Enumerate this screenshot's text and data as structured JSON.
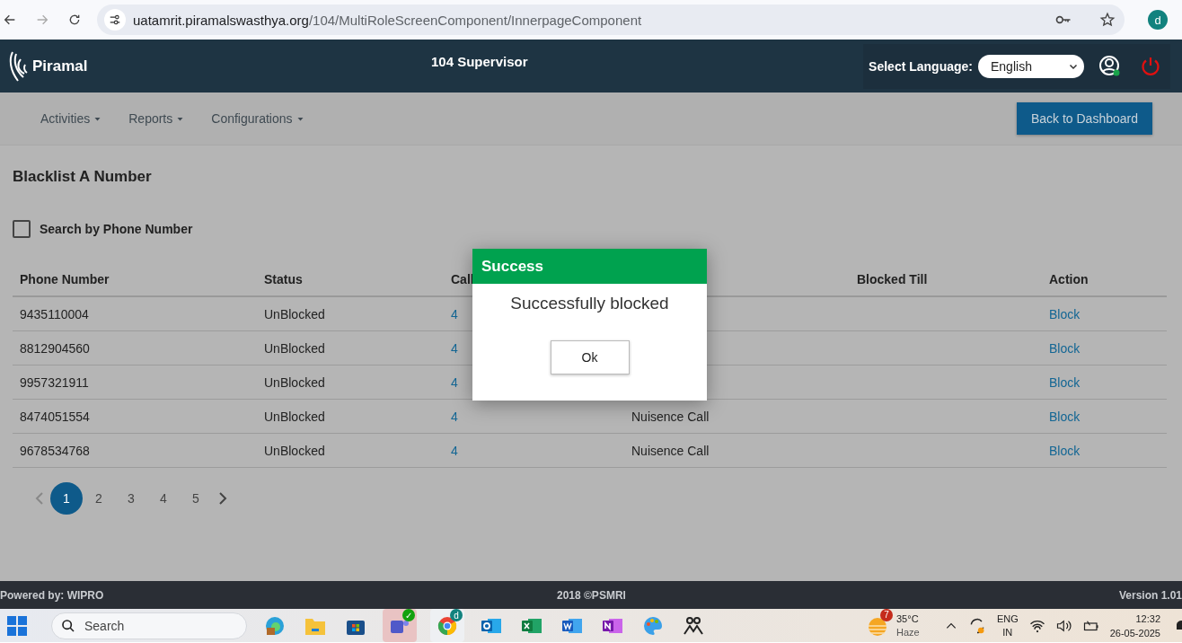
{
  "browser": {
    "url_host": "uatamrit.piramalswasthya.org",
    "url_path": "/104/MultiRoleScreenComponent/InnerpageComponent",
    "profile_initial": "d"
  },
  "header": {
    "logo_text": "Piramal",
    "title": "104 Supervisor",
    "language_label": "Select Language:",
    "language_value": "English"
  },
  "nav": {
    "menus": [
      {
        "label": "Activities"
      },
      {
        "label": "Reports"
      },
      {
        "label": "Configurations"
      }
    ],
    "back_button": "Back to Dashboard"
  },
  "page": {
    "title": "Blacklist A Number",
    "search_checkbox": {
      "label": "Search by Phone Number",
      "checked": false
    }
  },
  "table": {
    "header": {
      "phone_number": "Phone Number",
      "status": "Status",
      "column_3": "Call",
      "blocked_till": "Blocked Till",
      "action": "Action"
    },
    "rows": [
      {
        "phone_number": "9435110004",
        "status": "UnBlocked",
        "column_3": "4",
        "action": "Block"
      },
      {
        "phone_number": "8812904560",
        "status": "UnBlocked",
        "column_3": "4",
        "action": "Block"
      },
      {
        "phone_number": "9957321911",
        "status": "UnBlocked",
        "column_3": "4",
        "action": "Block"
      },
      {
        "phone_number": "8474051554",
        "status": "UnBlocked",
        "column_3": "4",
        "column_4": "Nuisence Call",
        "action": "Block"
      },
      {
        "phone_number": "9678534768",
        "status": "UnBlocked",
        "column_3": "4",
        "column_4": "Nuisence Call",
        "action": "Block"
      }
    ]
  },
  "pagination": {
    "pages": [
      {
        "label": "1",
        "selected": true
      },
      {
        "label": "2",
        "selected": false
      },
      {
        "label": "3",
        "selected": false
      },
      {
        "label": "4",
        "selected": false
      },
      {
        "label": "5",
        "selected": false
      }
    ]
  },
  "modal": {
    "title": "Success",
    "message": "Successfully blocked",
    "button": "Ok"
  },
  "footer": {
    "left": "Powered by: WIPRO",
    "center": "2018 ©PSMRI",
    "right": "Version 1.01"
  },
  "taskbar": {
    "search_placeholder": "Search",
    "teams_badge": "✓",
    "chrome_badge": "d",
    "weather_badge": "7",
    "temperature": "35°C",
    "condition": "Haze",
    "language": "ENG",
    "region": "IN",
    "time": "12:32",
    "date": "26-05-2025"
  }
}
